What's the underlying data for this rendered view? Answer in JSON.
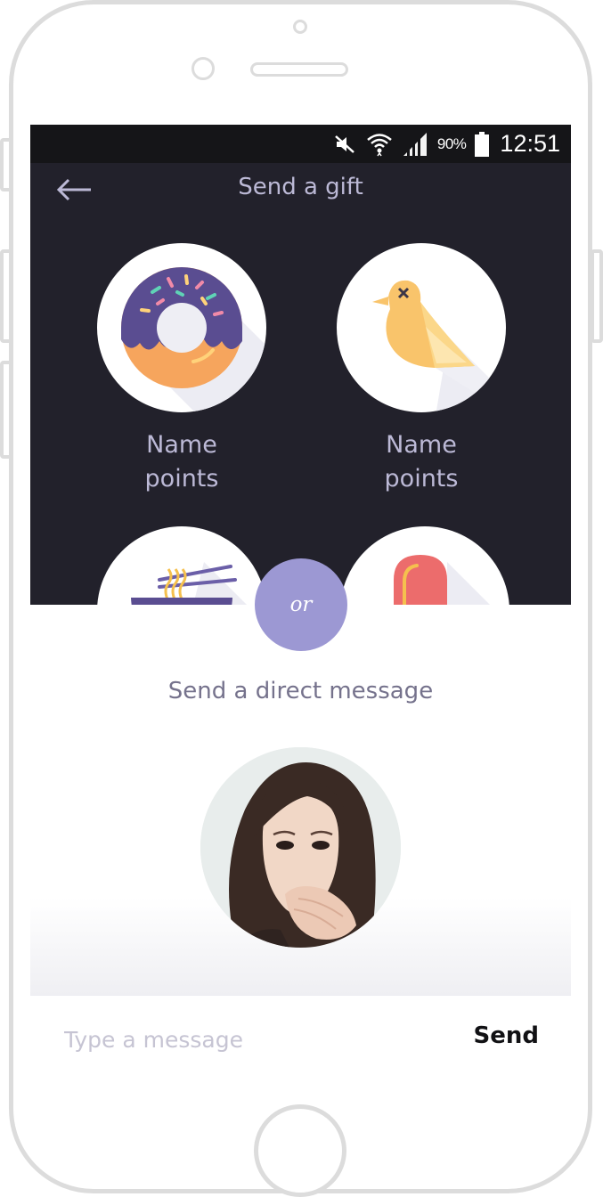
{
  "status_bar": {
    "battery_percent": "90%",
    "time": "12:51",
    "icons": [
      "mute-icon",
      "wifi-icon",
      "signal-icon",
      "battery-icon"
    ]
  },
  "header": {
    "title": "Send a gift",
    "back_icon": "arrow-left-icon"
  },
  "gifts": [
    {
      "icon": "donut-icon",
      "name": "Name",
      "points": "points"
    },
    {
      "icon": "bird-icon",
      "name": "Name",
      "points": "points"
    },
    {
      "icon": "noodle-bowl-icon"
    },
    {
      "icon": "popsicle-icon"
    }
  ],
  "divider": {
    "label": "or"
  },
  "direct_message": {
    "title": "Send a direct message",
    "avatar": "user-avatar"
  },
  "composer": {
    "placeholder": "Type a message",
    "send_label": "Send"
  },
  "colors": {
    "dark_bg": "#22212b",
    "accent": "#9c98d3",
    "label": "#bcb9d6",
    "text_muted": "#75728c"
  }
}
